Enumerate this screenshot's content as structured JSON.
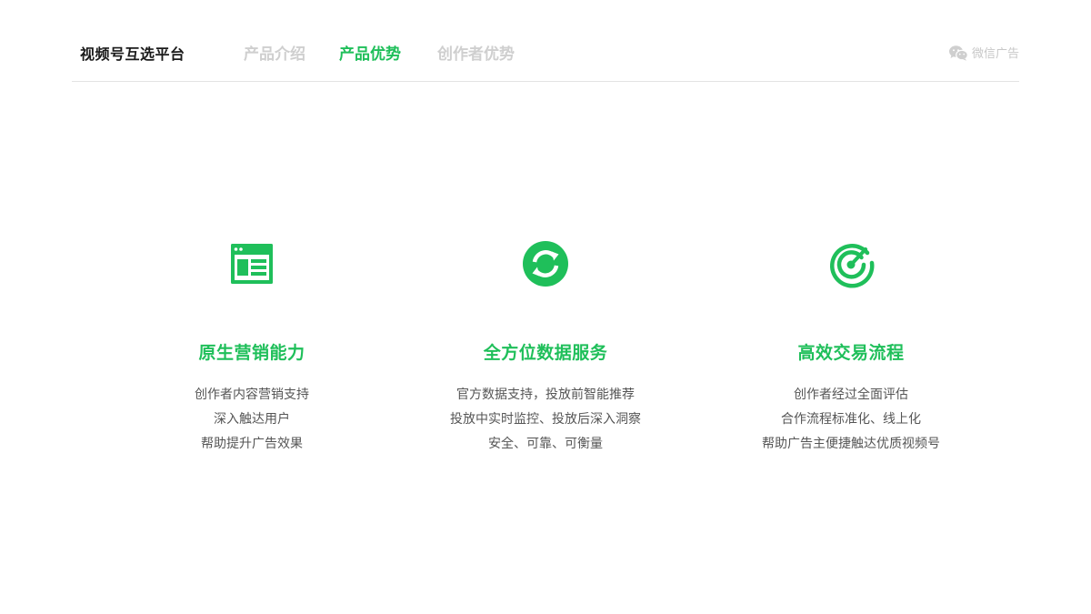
{
  "header": {
    "brand": "视频号互选平台",
    "tabs": [
      {
        "label": "产品介绍",
        "active": false
      },
      {
        "label": "产品优势",
        "active": true
      },
      {
        "label": "创作者优势",
        "active": false
      }
    ],
    "wechat_link": {
      "icon": "wechat-icon",
      "label": "微信广告"
    }
  },
  "features": [
    {
      "icon": "browser-window-icon",
      "title": "原生营销能力",
      "lines": [
        "创作者内容营销支持",
        "深入触达用户",
        "帮助提升广告效果"
      ]
    },
    {
      "icon": "refresh-cycle-icon",
      "title": "全方位数据服务",
      "lines": [
        "官方数据支持，投放前智能推荐",
        "投放中实时监控、投放后深入洞察",
        "安全、可靠、可衡量"
      ]
    },
    {
      "icon": "target-icon",
      "title": "高效交易流程",
      "lines": [
        "创作者经过全面评估",
        "合作流程标准化、线上化",
        "帮助广告主便捷触达优质视频号"
      ]
    }
  ],
  "colors": {
    "accent": "#1fbf5a",
    "nav_inactive": "#cfcfcf",
    "brand_text": "#1a1a1a",
    "body_text": "#555555"
  }
}
